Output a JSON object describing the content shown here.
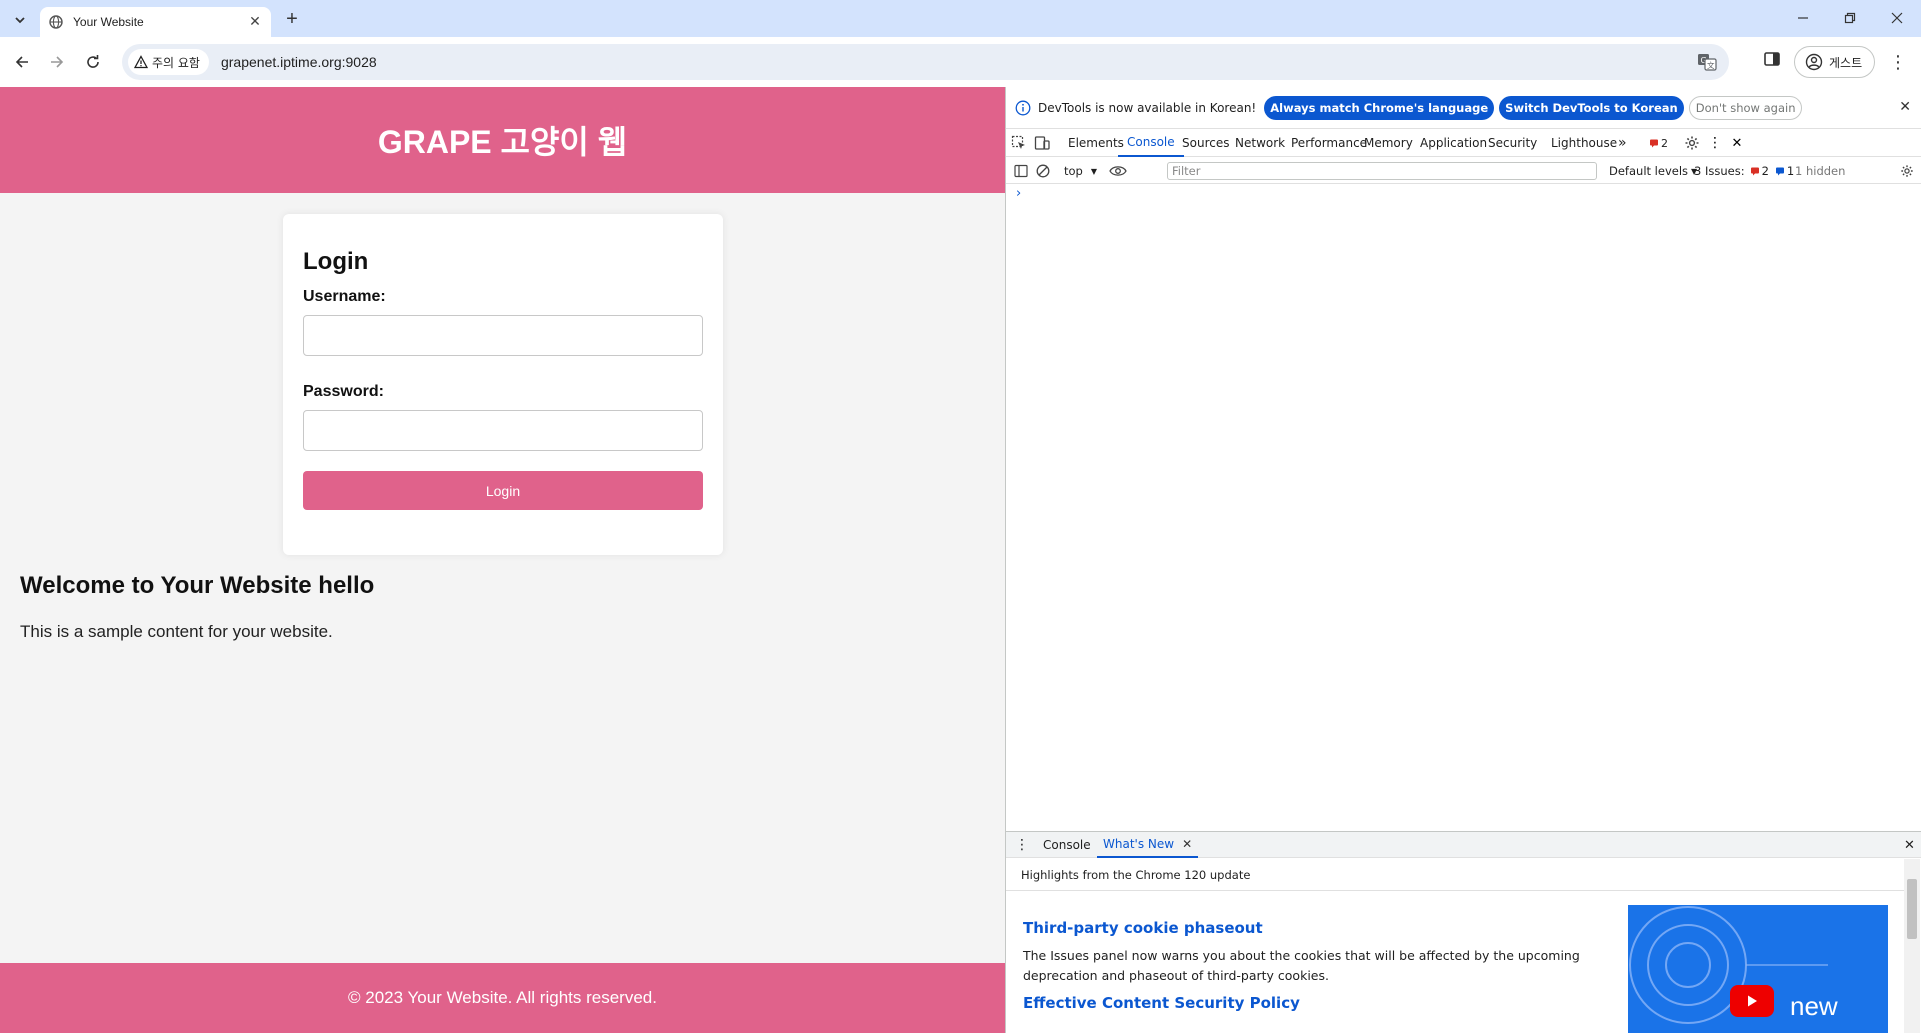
{
  "browser": {
    "tab_title": "Your Website",
    "security_label": "주의 요함",
    "url": "grapenet.iptime.org:9028",
    "profile_label": "게스트"
  },
  "site": {
    "header_title": "GRAPE 고양이 웹",
    "login_heading": "Login",
    "username_label": "Username:",
    "password_label": "Password:",
    "login_button": "Login",
    "welcome_heading": "Welcome to Your Website hello",
    "welcome_body": "This is a sample content for your website.",
    "footer": "© 2023 Your Website. All rights reserved.",
    "accent_color": "#e0628b"
  },
  "devtools": {
    "infobar_text": "DevTools is now available in Korean!",
    "btn_match_language": "Always match Chrome's language",
    "btn_switch_korean": "Switch DevTools to Korean",
    "btn_dont_show": "Don't show again",
    "tabs": [
      "Elements",
      "Console",
      "Sources",
      "Network",
      "Performance",
      "Memory",
      "Application",
      "Security",
      "Lighthouse"
    ],
    "issues_badge_count": "2",
    "context": "top",
    "filter_placeholder": "Filter",
    "default_levels": "Default levels",
    "issues_label": "3 Issues:",
    "issues_errors": "2",
    "issues_info": "1",
    "hidden_label": "1 hidden",
    "drawer_tabs": [
      "Console",
      "What's New"
    ],
    "whats_new": {
      "highlights": "Highlights from the Chrome 120 update",
      "heading1": "Third-party cookie phaseout",
      "paragraph1": "The Issues panel now warns you about the cookies that will be affected by the upcoming deprecation and phaseout of third-party cookies.",
      "heading2": "Effective Content Security Policy",
      "image_caption": "new"
    }
  }
}
